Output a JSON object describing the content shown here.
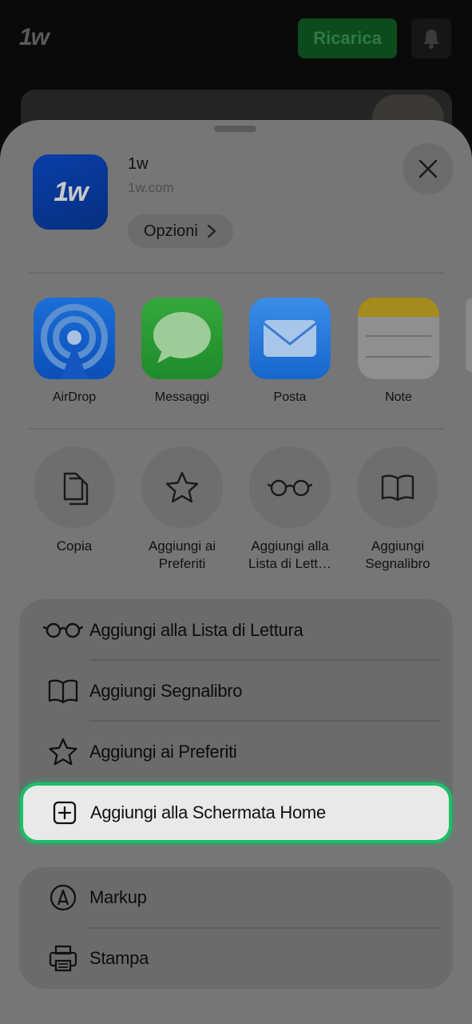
{
  "background": {
    "logo": "1w",
    "recharge_label": "Ricarica"
  },
  "site": {
    "name": "1w",
    "url": "1w.com",
    "icon_text": "1w",
    "options_label": "Opzioni"
  },
  "share_apps": [
    {
      "label": "AirDrop",
      "icon": "airdrop-icon"
    },
    {
      "label": "Messaggi",
      "icon": "messages-icon"
    },
    {
      "label": "Posta",
      "icon": "mail-icon"
    },
    {
      "label": "Note",
      "icon": "notes-icon"
    }
  ],
  "quick_actions": [
    {
      "label": "Copia",
      "icon": "copy-icon"
    },
    {
      "label": "Aggiungi ai Preferiti",
      "icon": "star-icon"
    },
    {
      "label": "Aggiungi alla Lista di Lett…",
      "icon": "glasses-icon"
    },
    {
      "label": "Aggiungi Segnalibro",
      "icon": "book-icon"
    }
  ],
  "menu_group_1": [
    {
      "label": "Aggiungi alla Lista di Lettura",
      "icon": "glasses-icon"
    },
    {
      "label": "Aggiungi Segnalibro",
      "icon": "book-icon"
    },
    {
      "label": "Aggiungi ai Preferiti",
      "icon": "star-icon"
    },
    {
      "label": "Aggiungi alla Schermata Home",
      "icon": "add-square-icon",
      "highlighted": true
    }
  ],
  "menu_group_2": [
    {
      "label": "Markup",
      "icon": "markup-icon"
    },
    {
      "label": "Stampa",
      "icon": "print-icon"
    }
  ],
  "colors": {
    "highlight_border": "#1cbf63",
    "recharge_button": "#0d4a1d"
  }
}
